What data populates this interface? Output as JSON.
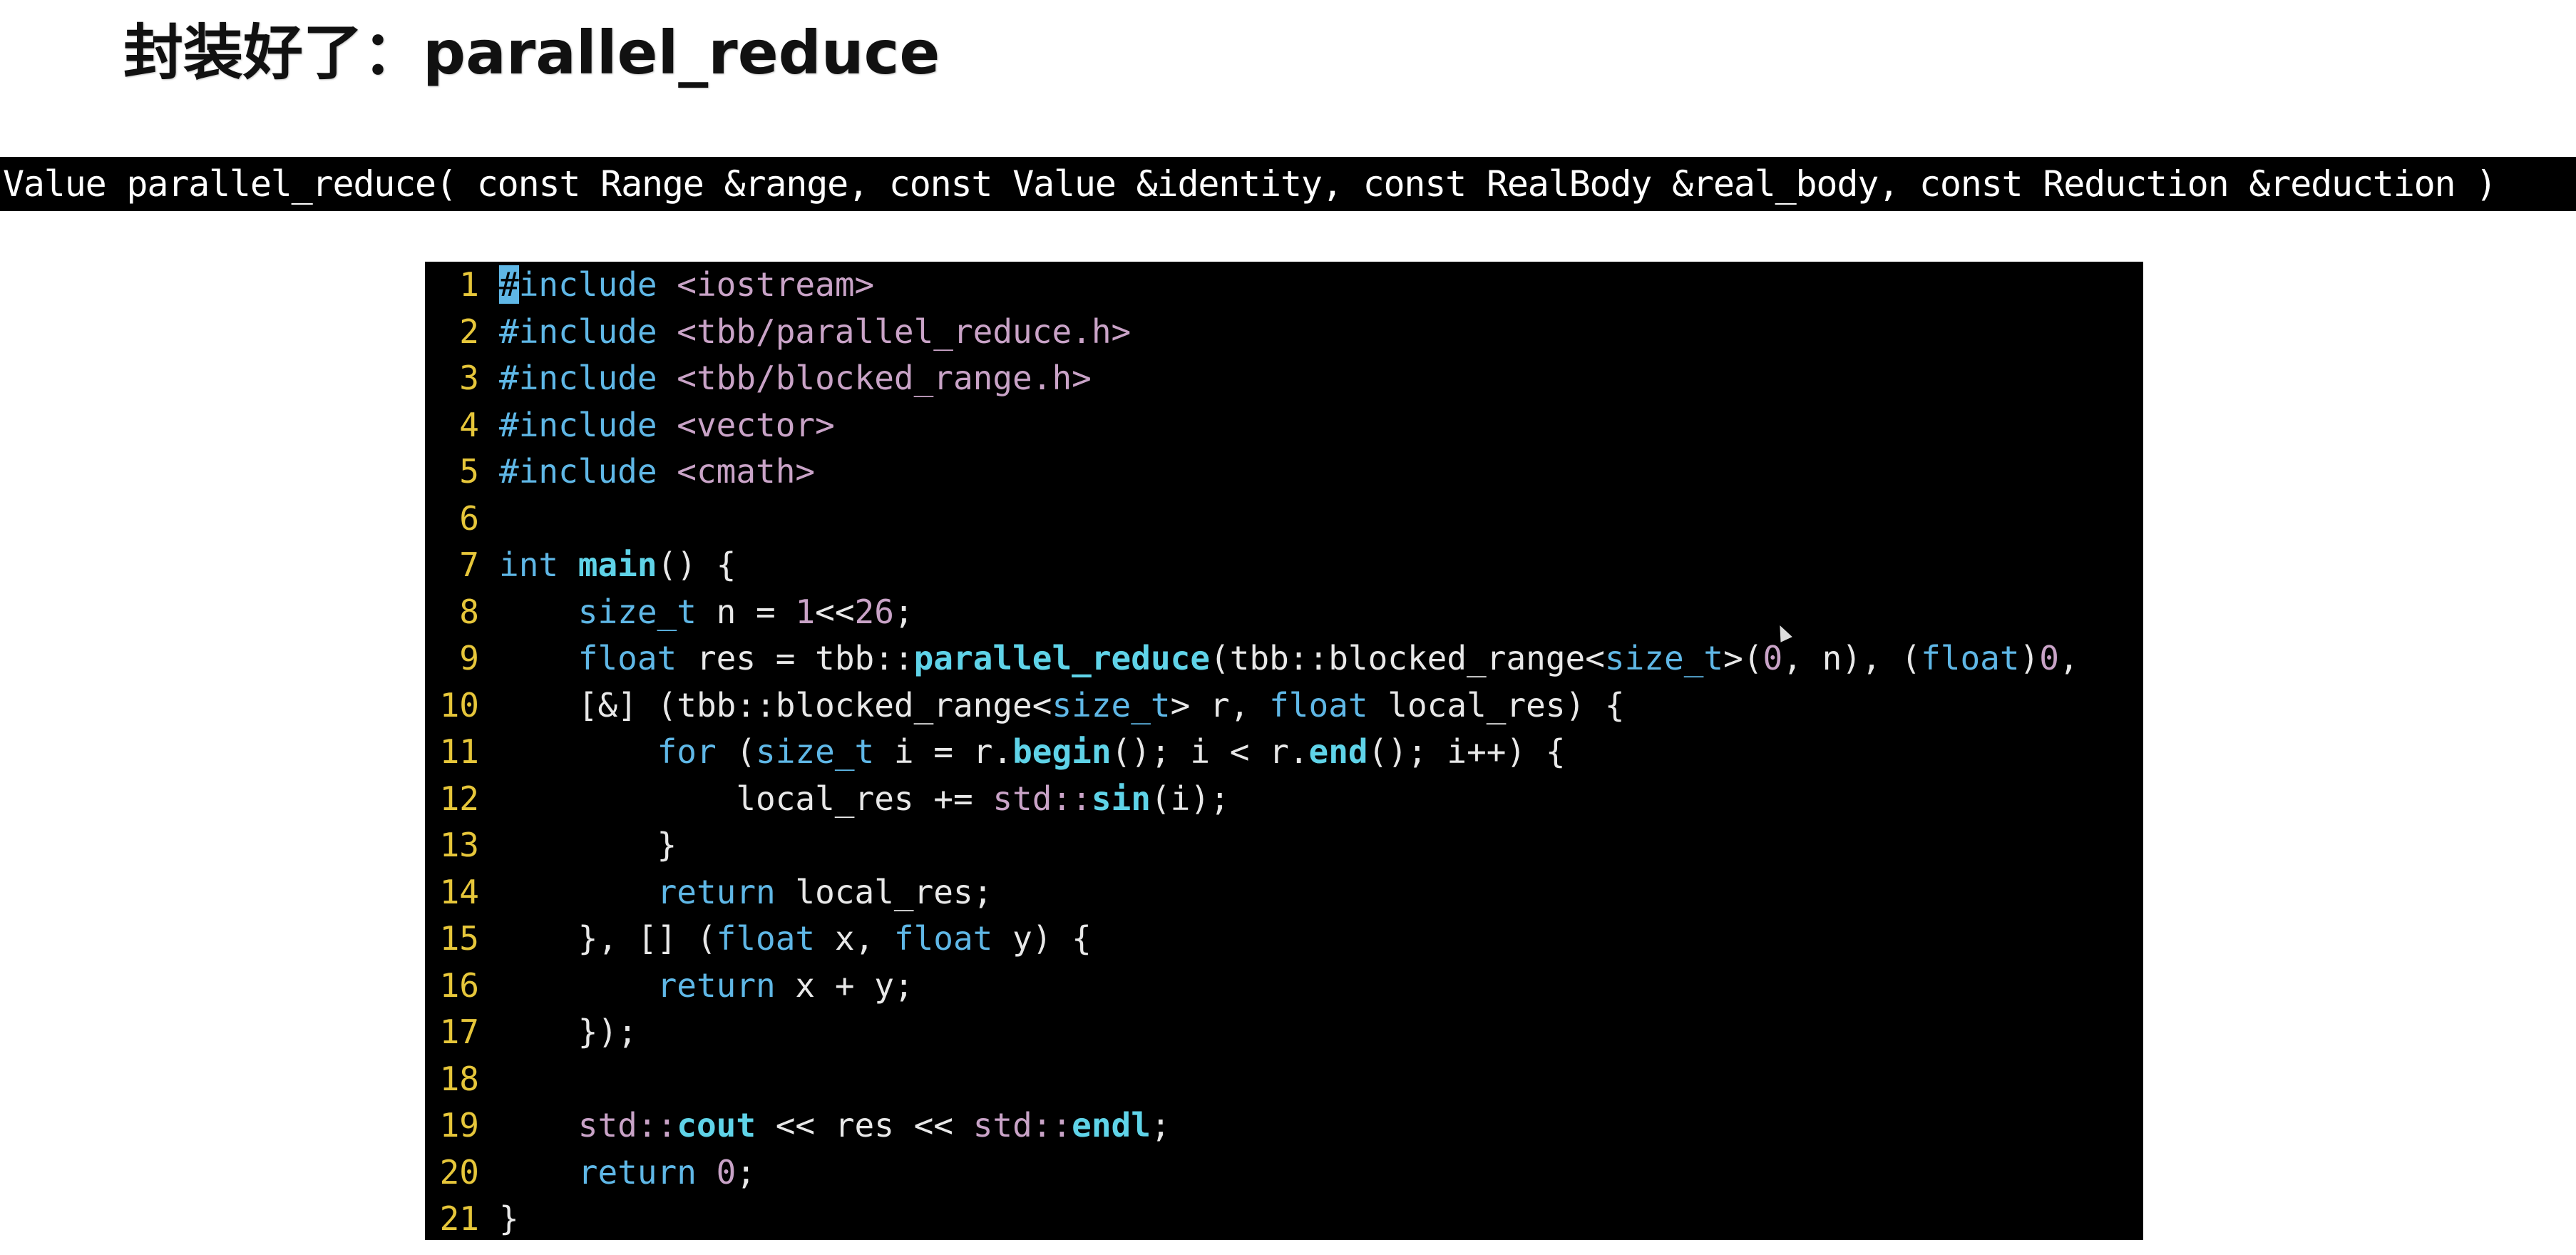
{
  "slide": {
    "title": "封装好了：parallel_reduce"
  },
  "signature": {
    "text": "Value parallel_reduce( const Range &range, const Value &identity, const RealBody &real_body, const Reduction &reduction )"
  },
  "editor": {
    "lines": [
      {
        "num": "1",
        "tokens": [
          [
            "cursor",
            "#"
          ],
          [
            "pp",
            "include "
          ],
          [
            "str",
            "<iostream>"
          ]
        ]
      },
      {
        "num": "2",
        "tokens": [
          [
            "pp",
            "#include "
          ],
          [
            "str",
            "<tbb/parallel_reduce.h>"
          ]
        ]
      },
      {
        "num": "3",
        "tokens": [
          [
            "pp",
            "#include "
          ],
          [
            "str",
            "<tbb/blocked_range.h>"
          ]
        ]
      },
      {
        "num": "4",
        "tokens": [
          [
            "pp",
            "#include "
          ],
          [
            "str",
            "<vector>"
          ]
        ]
      },
      {
        "num": "5",
        "tokens": [
          [
            "pp",
            "#include "
          ],
          [
            "str",
            "<cmath>"
          ]
        ]
      },
      {
        "num": "6",
        "tokens": []
      },
      {
        "num": "7",
        "tokens": [
          [
            "kw",
            "int "
          ],
          [
            "fn",
            "main"
          ],
          [
            "code",
            "() {"
          ]
        ]
      },
      {
        "num": "8",
        "tokens": [
          [
            "code",
            "    "
          ],
          [
            "kw",
            "size_t"
          ],
          [
            "code",
            " n = "
          ],
          [
            "num",
            "1"
          ],
          [
            "code",
            "<<"
          ],
          [
            "num",
            "26"
          ],
          [
            "code",
            ";"
          ]
        ]
      },
      {
        "num": "9",
        "tokens": [
          [
            "code",
            "    "
          ],
          [
            "kw",
            "float"
          ],
          [
            "code",
            " res = tbb::"
          ],
          [
            "fn",
            "parallel_reduce"
          ],
          [
            "code",
            "(tbb::blocked_range<"
          ],
          [
            "kw",
            "size_t"
          ],
          [
            "code",
            ">("
          ],
          [
            "num",
            "0"
          ],
          [
            "code",
            ", n), ("
          ],
          [
            "kw",
            "float"
          ],
          [
            "code",
            ")"
          ],
          [
            "num",
            "0"
          ],
          [
            "code",
            ","
          ]
        ]
      },
      {
        "num": "10",
        "tokens": [
          [
            "code",
            "    [&] (tbb::blocked_range<"
          ],
          [
            "kw",
            "size_t"
          ],
          [
            "code",
            "> r, "
          ],
          [
            "kw",
            "float"
          ],
          [
            "code",
            " local_res) {"
          ]
        ]
      },
      {
        "num": "11",
        "tokens": [
          [
            "code",
            "        "
          ],
          [
            "kw",
            "for"
          ],
          [
            "code",
            " ("
          ],
          [
            "kw",
            "size_t"
          ],
          [
            "code",
            " i = r."
          ],
          [
            "fn",
            "begin"
          ],
          [
            "code",
            "(); i < r."
          ],
          [
            "fn",
            "end"
          ],
          [
            "code",
            "(); i++) {"
          ]
        ]
      },
      {
        "num": "12",
        "tokens": [
          [
            "code",
            "            local_res += "
          ],
          [
            "ns",
            "std::"
          ],
          [
            "fn",
            "sin"
          ],
          [
            "code",
            "(i);"
          ]
        ]
      },
      {
        "num": "13",
        "tokens": [
          [
            "code",
            "        }"
          ]
        ]
      },
      {
        "num": "14",
        "tokens": [
          [
            "code",
            "        "
          ],
          [
            "kw",
            "return"
          ],
          [
            "code",
            " local_res;"
          ]
        ]
      },
      {
        "num": "15",
        "tokens": [
          [
            "code",
            "    }, [] ("
          ],
          [
            "kw",
            "float"
          ],
          [
            "code",
            " x, "
          ],
          [
            "kw",
            "float"
          ],
          [
            "code",
            " y) {"
          ]
        ]
      },
      {
        "num": "16",
        "tokens": [
          [
            "code",
            "        "
          ],
          [
            "kw",
            "return"
          ],
          [
            "code",
            " x + y;"
          ]
        ]
      },
      {
        "num": "17",
        "tokens": [
          [
            "code",
            "    });"
          ]
        ]
      },
      {
        "num": "18",
        "tokens": []
      },
      {
        "num": "19",
        "tokens": [
          [
            "code",
            "    "
          ],
          [
            "ns",
            "std::"
          ],
          [
            "fn",
            "cout"
          ],
          [
            "code",
            " << res << "
          ],
          [
            "ns",
            "std::"
          ],
          [
            "fn",
            "endl"
          ],
          [
            "code",
            ";"
          ]
        ]
      },
      {
        "num": "20",
        "tokens": [
          [
            "code",
            "    "
          ],
          [
            "kw",
            "return"
          ],
          [
            "code",
            " "
          ],
          [
            "num",
            "0"
          ],
          [
            "code",
            ";"
          ]
        ]
      },
      {
        "num": "21",
        "tokens": [
          [
            "code",
            "}"
          ]
        ]
      }
    ]
  },
  "colors": {
    "background": "#ffffff",
    "editor_bg": "#000000",
    "line_number": "#e6c63a",
    "keyword": "#5fb7e6",
    "function": "#5fd3e8",
    "string": "#c9a3c7"
  }
}
